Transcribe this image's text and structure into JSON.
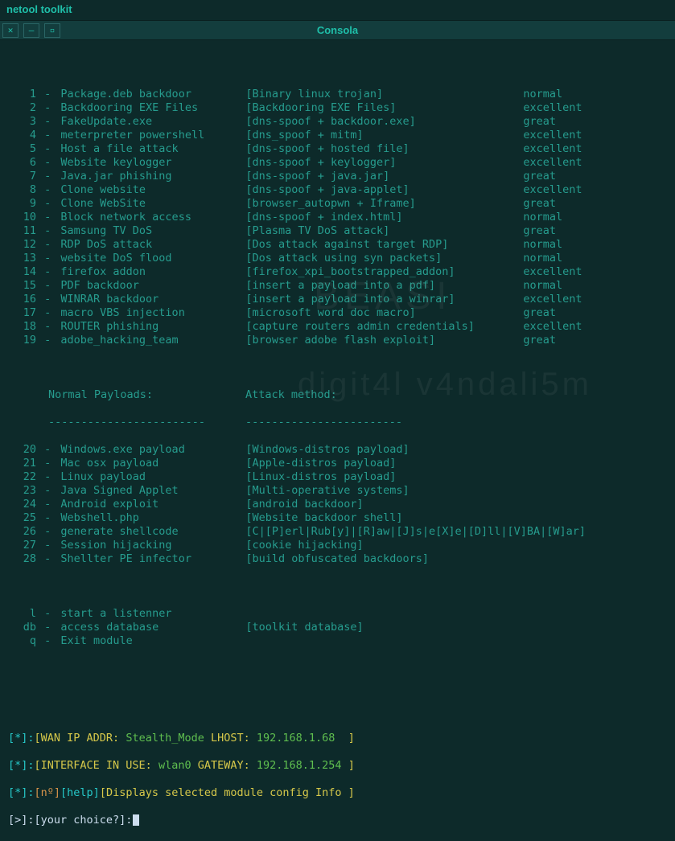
{
  "window": {
    "title": "netool toolkit",
    "tab": "Consola"
  },
  "watermark": {
    "line1": "BEASI",
    "line2": "digit4l v4ndali5m"
  },
  "modules": [
    {
      "n": "1",
      "name": "Package.deb backdoor",
      "desc": "[Binary linux trojan]",
      "rate": "normal"
    },
    {
      "n": "2",
      "name": "Backdooring EXE Files",
      "desc": "[Backdooring EXE Files]",
      "rate": "excellent"
    },
    {
      "n": "3",
      "name": "FakeUpdate.exe",
      "desc": "[dns-spoof + backdoor.exe]",
      "rate": "great"
    },
    {
      "n": "4",
      "name": "meterpreter powershell",
      "desc": "[dns_spoof + mitm]",
      "rate": "excellent"
    },
    {
      "n": "5",
      "name": "Host a file attack",
      "desc": "[dns-spoof + hosted file]",
      "rate": "excellent"
    },
    {
      "n": "6",
      "name": "Website keylogger",
      "desc": "[dns-spoof + keylogger]",
      "rate": "excellent"
    },
    {
      "n": "7",
      "name": "Java.jar phishing",
      "desc": "[dns-spoof + java.jar]",
      "rate": "great"
    },
    {
      "n": "8",
      "name": "Clone website",
      "desc": "[dns-spoof + java-applet]",
      "rate": "excellent"
    },
    {
      "n": "9",
      "name": "Clone WebSite",
      "desc": "[browser_autopwn + Iframe]",
      "rate": "great"
    },
    {
      "n": "10",
      "name": "Block network access",
      "desc": "[dns-spoof + index.html]",
      "rate": "normal"
    },
    {
      "n": "11",
      "name": "Samsung TV DoS",
      "desc": "[Plasma TV DoS attack]",
      "rate": "great"
    },
    {
      "n": "12",
      "name": "RDP DoS attack",
      "desc": "[Dos attack against target RDP]",
      "rate": "normal"
    },
    {
      "n": "13",
      "name": "website DoS flood",
      "desc": "[Dos attack using syn packets]",
      "rate": "normal"
    },
    {
      "n": "14",
      "name": "firefox addon",
      "desc": "[firefox_xpi_bootstrapped_addon]",
      "rate": "excellent"
    },
    {
      "n": "15",
      "name": "PDF backdoor",
      "desc": "[insert a payload into a pdf]",
      "rate": "normal"
    },
    {
      "n": "16",
      "name": "WINRAR backdoor",
      "desc": "[insert a payload into a winrar]",
      "rate": "excellent"
    },
    {
      "n": "17",
      "name": "macro VBS injection",
      "desc": "[microsoft word doc macro]",
      "rate": "great"
    },
    {
      "n": "18",
      "name": "ROUTER phishing",
      "desc": "[capture routers admin credentials]",
      "rate": "excellent"
    },
    {
      "n": "19",
      "name": "adobe_hacking_team",
      "desc": "[browser adobe flash exploit]",
      "rate": "great"
    }
  ],
  "section2": {
    "left_header": "Normal Payloads:",
    "right_header": "Attack method:",
    "dashes_left": "------------------------",
    "dashes_right": "------------------------"
  },
  "payloads": [
    {
      "n": "20",
      "name": "Windows.exe payload",
      "desc": "[Windows-distros payload]"
    },
    {
      "n": "21",
      "name": "Mac osx payload",
      "desc": "[Apple-distros payload]"
    },
    {
      "n": "22",
      "name": "Linux payload",
      "desc": "[Linux-distros payload]"
    },
    {
      "n": "23",
      "name": "Java Signed Applet",
      "desc": "[Multi-operative systems]"
    },
    {
      "n": "24",
      "name": "Android exploit",
      "desc": "[android backdoor]"
    },
    {
      "n": "25",
      "name": "Webshell.php",
      "desc": "[Website backdoor shell]"
    },
    {
      "n": "26",
      "name": "generate shellcode",
      "desc": "[C|[P]erl|Rub[y]|[R]aw|[J]s|e[X]e|[D]ll|[V]BA|[W]ar]"
    },
    {
      "n": "27",
      "name": "Session hijacking",
      "desc": "[cookie hijacking]"
    },
    {
      "n": "28",
      "name": "Shellter PE infector",
      "desc": "[build obfuscated backdoors]"
    }
  ],
  "extras": [
    {
      "n": "l",
      "name": "start a listenner",
      "desc": ""
    },
    {
      "n": "db",
      "name": "access database",
      "desc": "[toolkit database]"
    },
    {
      "n": "q",
      "name": "Exit module",
      "desc": ""
    }
  ],
  "status": {
    "line1": {
      "prefix": "[*]:",
      "label": "[WAN IP ADDR:",
      "val": " Stealth_Mode",
      "lhost": " LHOST: ",
      "ip": "192.168.1.68",
      "close": "  ]"
    },
    "line2": {
      "prefix": "[*]:",
      "label": "[INTERFACE IN USE:",
      "iface": " wlan0",
      "gw": " GATEWAY: ",
      "ip": "192.168.1.254",
      "close": " ]"
    },
    "line3": {
      "prefix": "[*]:",
      "n": "[nº]",
      "help": "[help]",
      "rest": "[Displays selected module config Info ]"
    },
    "prompt": {
      "lead": "[>]:",
      "ask": "[your choice?]:"
    }
  }
}
